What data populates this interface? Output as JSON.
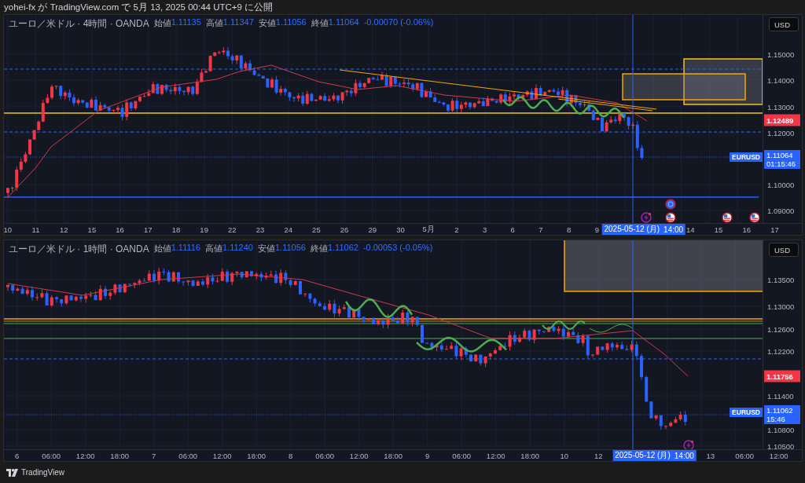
{
  "header": {
    "text": "yohei-fx が TradingView.com で 5月 13, 2025 00:44 UTC+9 に公開"
  },
  "panels": [
    {
      "legend": {
        "title": "ユーロ／米ドル · 4時間 · OANDA",
        "ohlc": [
          {
            "label": "始値",
            "value": "1.11135"
          },
          {
            "label": "高値",
            "value": "1.11347"
          },
          {
            "label": "安値",
            "value": "1.11056"
          },
          {
            "label": "終値",
            "value": "1.11064"
          }
        ],
        "change": "-0.00070 (-0.06%)"
      },
      "currency": "USD",
      "price_ticks": [
        "1.15000",
        "1.14000",
        "1.13000",
        "1.12000",
        "1.10000",
        "1.09000"
      ],
      "level_label": "1.12489",
      "last_price": {
        "symbol": "EURUSD",
        "price": "1.11064",
        "countdown": "01:15:46"
      },
      "time_axis": [
        {
          "kind": "tick",
          "text": "10"
        },
        {
          "kind": "tick",
          "text": "11"
        },
        {
          "kind": "tick",
          "text": "12"
        },
        {
          "kind": "tick",
          "text": "15"
        },
        {
          "kind": "tick",
          "text": "16"
        },
        {
          "kind": "tick",
          "text": "17"
        },
        {
          "kind": "tick",
          "text": "18"
        },
        {
          "kind": "tick",
          "text": "19"
        },
        {
          "kind": "tick",
          "text": "22"
        },
        {
          "kind": "tick",
          "text": "23"
        },
        {
          "kind": "tick",
          "text": "24"
        },
        {
          "kind": "tick",
          "text": "25"
        },
        {
          "kind": "tick",
          "text": "26"
        },
        {
          "kind": "tick",
          "text": "29"
        },
        {
          "kind": "tick",
          "text": "30"
        },
        {
          "kind": "tick",
          "text": "5月"
        },
        {
          "kind": "tick",
          "text": "2"
        },
        {
          "kind": "tick",
          "text": "3"
        },
        {
          "kind": "tick",
          "text": "6"
        },
        {
          "kind": "tick",
          "text": "7"
        },
        {
          "kind": "tick",
          "text": "8"
        },
        {
          "kind": "tick",
          "text": "9"
        },
        {
          "kind": "crosshair",
          "date": "2025-05-12 (月)",
          "time": "14:00"
        },
        {
          "kind": "tick",
          "text": "14"
        },
        {
          "kind": "tick",
          "text": "15"
        },
        {
          "kind": "tick",
          "text": "16"
        },
        {
          "kind": "tick",
          "text": "17"
        }
      ]
    },
    {
      "legend": {
        "title": "ユーロ／米ドル · 1時間 · OANDA",
        "ohlc": [
          {
            "label": "始値",
            "value": "1.11116"
          },
          {
            "label": "高値",
            "value": "1.11240"
          },
          {
            "label": "安値",
            "value": "1.11056"
          },
          {
            "label": "終値",
            "value": "1.11062"
          }
        ],
        "change": "-0.00053 (-0.05%)"
      },
      "currency": "USD",
      "price_ticks": [
        "1.13500",
        "1.13000",
        "1.12600",
        "1.12200",
        "1.11400",
        "1.10800",
        "1.10500"
      ],
      "level_label": "1.11756",
      "last_price": {
        "symbol": "EURUSD",
        "price": "1.11062",
        "countdown": "15:46"
      },
      "time_axis": [
        {
          "kind": "tick",
          "text": "6"
        },
        {
          "kind": "tick",
          "text": "06:00"
        },
        {
          "kind": "tick",
          "text": "12:00"
        },
        {
          "kind": "tick",
          "text": "18:00"
        },
        {
          "kind": "tick",
          "text": "7"
        },
        {
          "kind": "tick",
          "text": "06:00"
        },
        {
          "kind": "tick",
          "text": "12:00"
        },
        {
          "kind": "tick",
          "text": "18:00"
        },
        {
          "kind": "tick",
          "text": "8"
        },
        {
          "kind": "tick",
          "text": "06:00"
        },
        {
          "kind": "tick",
          "text": "12:00"
        },
        {
          "kind": "tick",
          "text": "18:00"
        },
        {
          "kind": "tick",
          "text": "9"
        },
        {
          "kind": "tick",
          "text": "06:00"
        },
        {
          "kind": "tick",
          "text": "12:00"
        },
        {
          "kind": "tick",
          "text": "18:00"
        },
        {
          "kind": "tick",
          "text": "10"
        },
        {
          "kind": "tick",
          "text": "12"
        },
        {
          "kind": "crosshair",
          "date": "2025-05-12 (月)",
          "time": "14:00"
        },
        {
          "kind": "tick",
          "text": "13"
        },
        {
          "kind": "tick",
          "text": "06:00"
        },
        {
          "kind": "tick",
          "text": "12:00"
        }
      ]
    }
  ],
  "footer": {
    "brand": "TradingView"
  }
}
